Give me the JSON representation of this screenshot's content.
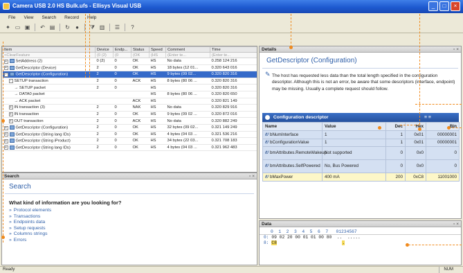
{
  "window": {
    "title": "Camera USB 2.0 HS Bulk.ufs - Ellisys Visual USB"
  },
  "menu": [
    "File",
    "View",
    "Search",
    "Record",
    "Help"
  ],
  "toolbar": [
    "new-icon",
    "open-icon",
    "save-icon",
    "sep",
    "back-icon",
    "view-icon",
    "sep",
    "loop-icon",
    "record-icon",
    "sep",
    "filter-icon",
    "chart-icon",
    "sep",
    "list-icon",
    "sep",
    "help-icon"
  ],
  "transactions": {
    "columns": [
      "Item",
      "Device",
      "Endp...",
      "Status",
      "Speed",
      "Comment",
      "Time"
    ],
    "filter": [
      "<ClearFeature",
      "(0 (2)",
      "(0",
      "(OK",
      "(HS",
      "(Enter te...",
      "(Enter te..."
    ],
    "rows": [
      {
        "item": "SetAddress (2)",
        "device": "0 (2)",
        "endp": "0",
        "status": "OK",
        "speed": "HS",
        "comment": "No data",
        "time": "0.258 124 216",
        "indent": 0,
        "exp": "+"
      },
      {
        "item": "GetDescriptor (Device)",
        "device": "2",
        "endp": "0",
        "status": "OK",
        "speed": "HS",
        "comment": "18 bytes (12 01...",
        "time": "0.320 643 016",
        "indent": 0,
        "exp": "+"
      },
      {
        "item": "GetDescriptor (Configuration)",
        "device": "2",
        "endp": "0",
        "status": "OK",
        "speed": "HS",
        "comment": "9 bytes (09 02...",
        "time": "0.320 820 316",
        "indent": 0,
        "exp": "-",
        "selected": true
      },
      {
        "item": "SETUP transaction",
        "device": "2",
        "endp": "0",
        "status": "ACK",
        "speed": "HS",
        "comment": "8 bytes (80 06 ...",
        "time": "0.320 820 316",
        "indent": 1,
        "exp": "-"
      },
      {
        "item": "SETUP packet",
        "device": "2",
        "endp": "0",
        "status": "",
        "speed": "HS",
        "comment": "",
        "time": "0.320 820 316",
        "indent": 2,
        "exp": ""
      },
      {
        "item": "DATA0 packet",
        "device": "",
        "endp": "",
        "status": "",
        "speed": "HS",
        "comment": "8 bytes (80 06 ...",
        "time": "0.320 820 650",
        "indent": 2,
        "exp": ""
      },
      {
        "item": "ACK packet",
        "device": "",
        "endp": "",
        "status": "ACK",
        "speed": "HS",
        "comment": "",
        "time": "0.320 821 149",
        "indent": 2,
        "exp": ""
      },
      {
        "item": "IN transaction (3)",
        "device": "2",
        "endp": "0",
        "status": "NAK",
        "speed": "HS",
        "comment": "No data",
        "time": "0.320 829 916",
        "indent": 1,
        "exp": "+"
      },
      {
        "item": "IN transaction",
        "device": "2",
        "endp": "0",
        "status": "OK",
        "speed": "HS",
        "comment": "9 bytes (09 02 ...",
        "time": "0.320 872 016",
        "indent": 1,
        "exp": "+"
      },
      {
        "item": "OUT transaction",
        "device": "2",
        "endp": "0",
        "status": "ACK",
        "speed": "HS",
        "comment": "No data",
        "time": "0.320 882 249",
        "indent": 1,
        "exp": "+"
      },
      {
        "item": "GetDescriptor (Configuration)",
        "device": "2",
        "endp": "0",
        "status": "OK",
        "speed": "HS",
        "comment": "32 bytes (09 02...",
        "time": "0.321 149 249",
        "indent": 0,
        "exp": "+"
      },
      {
        "item": "GetDescriptor (String lang IDs)",
        "device": "2",
        "endp": "0",
        "status": "OK",
        "speed": "HS",
        "comment": "4 bytes (04 03 ...",
        "time": "0.321 536 216",
        "indent": 0,
        "exp": "+"
      },
      {
        "item": "GetDescriptor (String iProduct)",
        "device": "2",
        "endp": "0",
        "status": "OK",
        "speed": "HS",
        "comment": "34 bytes (22 03...",
        "time": "0.321 708 183",
        "indent": 0,
        "exp": "+"
      },
      {
        "item": "GetDescriptor (String lang IDs)",
        "device": "2",
        "endp": "0",
        "status": "OK",
        "speed": "HS",
        "comment": "4 bytes (04 03 ...",
        "time": "0.321 962 483",
        "indent": 0,
        "exp": "+"
      }
    ]
  },
  "search": {
    "header": "Search",
    "title": "Search",
    "question": "What kind of information are you looking for?",
    "links": [
      "Protocol elements",
      "Transactions",
      "Endpoints data",
      "Setup requests",
      "Columns strings",
      "Errors"
    ]
  },
  "details": {
    "header": "Details",
    "title": "GetDescriptor (Configuration)",
    "description": "The host has requested less data than the total length specified in the configuration descriptor. Although this is not an error, be aware that some descriptors (interface, endpoint) may be missing. Usually a complete request should follow.",
    "config_title": "Configuration descriptor",
    "config_columns": [
      "Name",
      "Value",
      "Dec",
      "Hex",
      "Bin"
    ],
    "config_rows": [
      {
        "name": "bNumInterface",
        "value": "1",
        "dec": "1",
        "hex": "0x01",
        "bin": "00000001"
      },
      {
        "name": "bConfigurationValue",
        "value": "1",
        "dec": "1",
        "hex": "0x01",
        "bin": "00000001"
      },
      {
        "name": "bmAttributes.RemoteWakeup",
        "value": "Not supported",
        "dec": "0",
        "hex": "0x0",
        "bin": "0"
      },
      {
        "name": "bmAttributes.SelfPowered",
        "value": "No, Bus Powered",
        "dec": "0",
        "hex": "0x0",
        "bin": "0"
      },
      {
        "name": "bMaxPower",
        "value": "400 mA",
        "dec": "200",
        "hex": "0xC8",
        "bin": "11001000"
      }
    ]
  },
  "data": {
    "header": "Data",
    "hex_header": "0  1  2  3  4  5  6  7   01234567",
    "rows": [
      {
        "off": "0:",
        "hex": "09 02 20 00 01 01 00 80",
        "ascii": "..  ....."
      },
      {
        "off": "8:",
        "hex": "C8",
        "ascii": "."
      }
    ]
  },
  "status": {
    "left": "Ready",
    "right": "NUM"
  }
}
